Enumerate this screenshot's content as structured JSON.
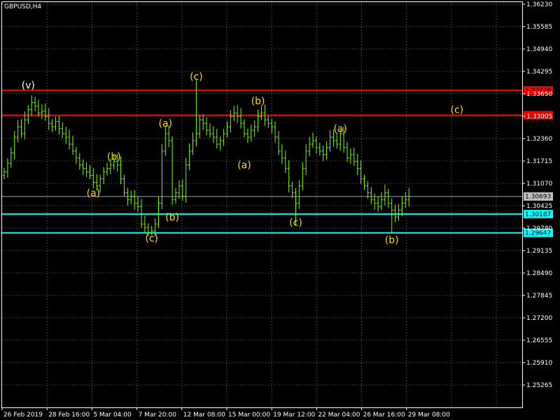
{
  "chart_data": {
    "type": "candlestick",
    "symbol_label": "GBPUSD,H4",
    "ylim": [
      1.222,
      1.365
    ],
    "y_ticks": [
      "1.36230",
      "1.35585",
      "1.34940",
      "1.34295",
      "1.33650",
      "1.33005",
      "1.32360",
      "1.31715",
      "1.31070",
      "1.30425",
      "1.29780",
      "1.29135",
      "1.28490",
      "1.27845",
      "1.27200",
      "1.26555",
      "1.25910",
      "1.25265"
    ],
    "x_ticks": [
      "26 Feb 2019",
      "28 Feb 16:00",
      "5 Mar 04:00",
      "7 Mar 20:00",
      "12 Mar 08:00",
      "15 Mar 00:00",
      "19 Mar 12:00",
      "22 Mar 04:00",
      "26 Mar 16:00",
      "29 Mar 08:00"
    ],
    "grid": true,
    "colors": {
      "background": "#000000",
      "candle": "#7cfc00",
      "grid": "#5a6e78",
      "resistance": "#ff0000",
      "support": "#00ffff",
      "wave_label": "#ffd700",
      "axis": "#ffffff"
    },
    "horizontal_lines": [
      {
        "value": 1.33748,
        "label": "1.33748",
        "kind": "resistance"
      },
      {
        "value": 1.33033,
        "label": "1.33033",
        "kind": "resistance"
      },
      {
        "value": 1.30693,
        "label": "1.30693",
        "kind": "current"
      },
      {
        "value": 1.30187,
        "label": "1.30187",
        "kind": "support"
      },
      {
        "value": 1.29647,
        "label": "1.29647",
        "kind": "support"
      }
    ],
    "wave_labels": [
      {
        "text": "(v)",
        "bar": 7,
        "price": 1.339,
        "color": "white"
      },
      {
        "text": "(b)",
        "bar": 32,
        "price": 1.3185
      },
      {
        "text": "(a)",
        "bar": 26,
        "price": 1.308
      },
      {
        "text": "(c)",
        "bar": 43,
        "price": 1.295
      },
      {
        "text": "(a)",
        "bar": 47,
        "price": 1.328
      },
      {
        "text": "(b)",
        "bar": 49,
        "price": 1.301
      },
      {
        "text": "(c)",
        "bar": 56,
        "price": 1.3415
      },
      {
        "text": "(a)",
        "bar": 70,
        "price": 1.316
      },
      {
        "text": "(b)",
        "bar": 74,
        "price": 1.3345
      },
      {
        "text": "(c)",
        "bar": 85,
        "price": 1.2995
      },
      {
        "text": "(a)",
        "bar": 98,
        "price": 1.3265
      },
      {
        "text": "(b)",
        "bar": 113,
        "price": 1.2945
      },
      {
        "text": "(c)",
        "bar": 132,
        "price": 1.332
      }
    ],
    "candles_close": [
      1.314,
      1.3165,
      1.3195,
      1.324,
      1.327,
      1.325,
      1.329,
      1.332,
      1.334,
      1.333,
      1.331,
      1.3315,
      1.33,
      1.328,
      1.327,
      1.3285,
      1.3265,
      1.325,
      1.324,
      1.322,
      1.32,
      1.318,
      1.316,
      1.315,
      1.314,
      1.313,
      1.311,
      1.31,
      1.312,
      1.314,
      1.315,
      1.316,
      1.317,
      1.316,
      1.312,
      1.308,
      1.306,
      1.307,
      1.305,
      1.304,
      1.299,
      1.298,
      1.2965,
      1.297,
      1.299,
      1.305,
      1.32,
      1.325,
      1.323,
      1.306,
      1.308,
      1.31,
      1.307,
      1.316,
      1.32,
      1.323,
      1.325,
      1.329,
      1.328,
      1.326,
      1.325,
      1.324,
      1.322,
      1.323,
      1.325,
      1.327,
      1.33,
      1.331,
      1.33,
      1.328,
      1.325,
      1.324,
      1.326,
      1.327,
      1.33,
      1.331,
      1.329,
      1.328,
      1.327,
      1.324,
      1.32,
      1.318,
      1.315,
      1.31,
      1.308,
      1.305,
      1.31,
      1.315,
      1.32,
      1.322,
      1.323,
      1.321,
      1.32,
      1.319,
      1.321,
      1.324,
      1.323,
      1.322,
      1.325,
      1.321,
      1.318,
      1.319,
      1.317,
      1.315,
      1.312,
      1.31,
      1.308,
      1.306,
      1.305,
      1.304,
      1.306,
      1.308,
      1.305,
      1.303,
      1.301,
      1.303,
      1.305,
      1.306,
      1.307
    ]
  }
}
